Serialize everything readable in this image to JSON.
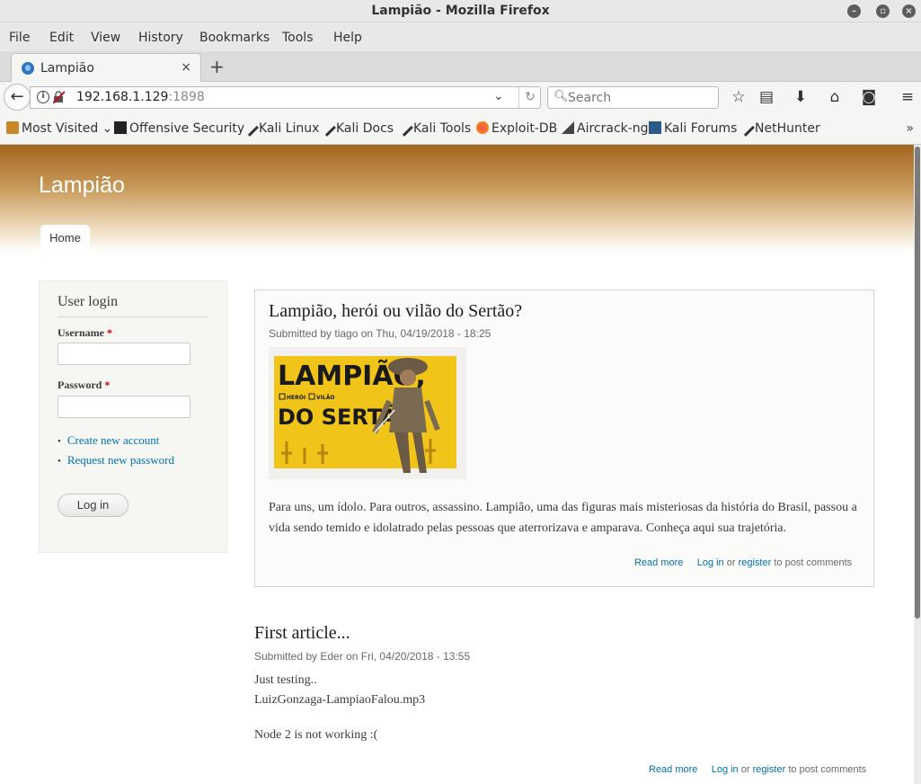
{
  "window": {
    "title": "Lampião - Mozilla Firefox"
  },
  "menu": [
    {
      "label": "File"
    },
    {
      "label": "Edit"
    },
    {
      "label": "View"
    },
    {
      "label": "History"
    },
    {
      "label": "Bookmarks"
    },
    {
      "label": "Tools"
    },
    {
      "label": "Help"
    }
  ],
  "tab": {
    "label": "Lampião",
    "close": "×"
  },
  "newtab": "+",
  "nav": {
    "url_host": "192.168.1.129",
    "url_port": ":1898",
    "search_placeholder": "Search"
  },
  "bookmarks": [
    {
      "label": "Most Visited",
      "icon": "folder-icon"
    },
    {
      "label": "Offensive Security",
      "icon": "offsec-icon"
    },
    {
      "label": "Kali Linux",
      "icon": "kali-icon"
    },
    {
      "label": "Kali Docs",
      "icon": "kali-icon"
    },
    {
      "label": "Kali Tools",
      "icon": "kali-icon"
    },
    {
      "label": "Exploit-DB",
      "icon": "exploitdb-icon"
    },
    {
      "label": "Aircrack-ng",
      "icon": "aircrack-icon"
    },
    {
      "label": "Kali Forums",
      "icon": "kali-forums-icon"
    },
    {
      "label": "NetHunter",
      "icon": "kali-icon"
    }
  ],
  "site": {
    "name": "Lampião",
    "primary_tab": "Home"
  },
  "login": {
    "title": "User login",
    "username_label": "Username",
    "password_label": "Password",
    "required_mark": "*",
    "links": [
      "Create new account",
      "Request new password"
    ],
    "button": "Log in"
  },
  "nodes": [
    {
      "title": "Lampião, herói ou vilão do Sertão?",
      "submitted": "Submitted by tiago on Thu, 04/19/2018 - 18:25",
      "image_text": [
        "LAMPIÃO,",
        "HERÓI",
        "VILÃO",
        "DO SERTÃO"
      ],
      "body": "Para uns, um ídolo. Para outros, assassino. Lampião, uma das figuras mais misteriosas da história do Brasil, passou a vida sendo temido e idolatrado pelas pessoas que aterrorizava e amparava. Conheça aqui sua trajetória.",
      "read_more": "Read more",
      "login": "Log in",
      "or": "or",
      "register": "register",
      "post_comments": "to post comments"
    },
    {
      "title": "First article...",
      "submitted": "Submitted by Eder on Fri, 04/20/2018 - 13:55",
      "body_lines": [
        "Just testing..",
        "LuizGonzaga-LampiaoFalou.mp3"
      ],
      "body2": "Node 2 is not working :(",
      "read_more": "Read more",
      "login": "Log in",
      "or": "or",
      "register": "register",
      "post_comments": "to post comments"
    }
  ],
  "colors": {
    "header_brown": "#a4661f",
    "link_blue": "#0071b3",
    "required_red": "#cc0000"
  }
}
